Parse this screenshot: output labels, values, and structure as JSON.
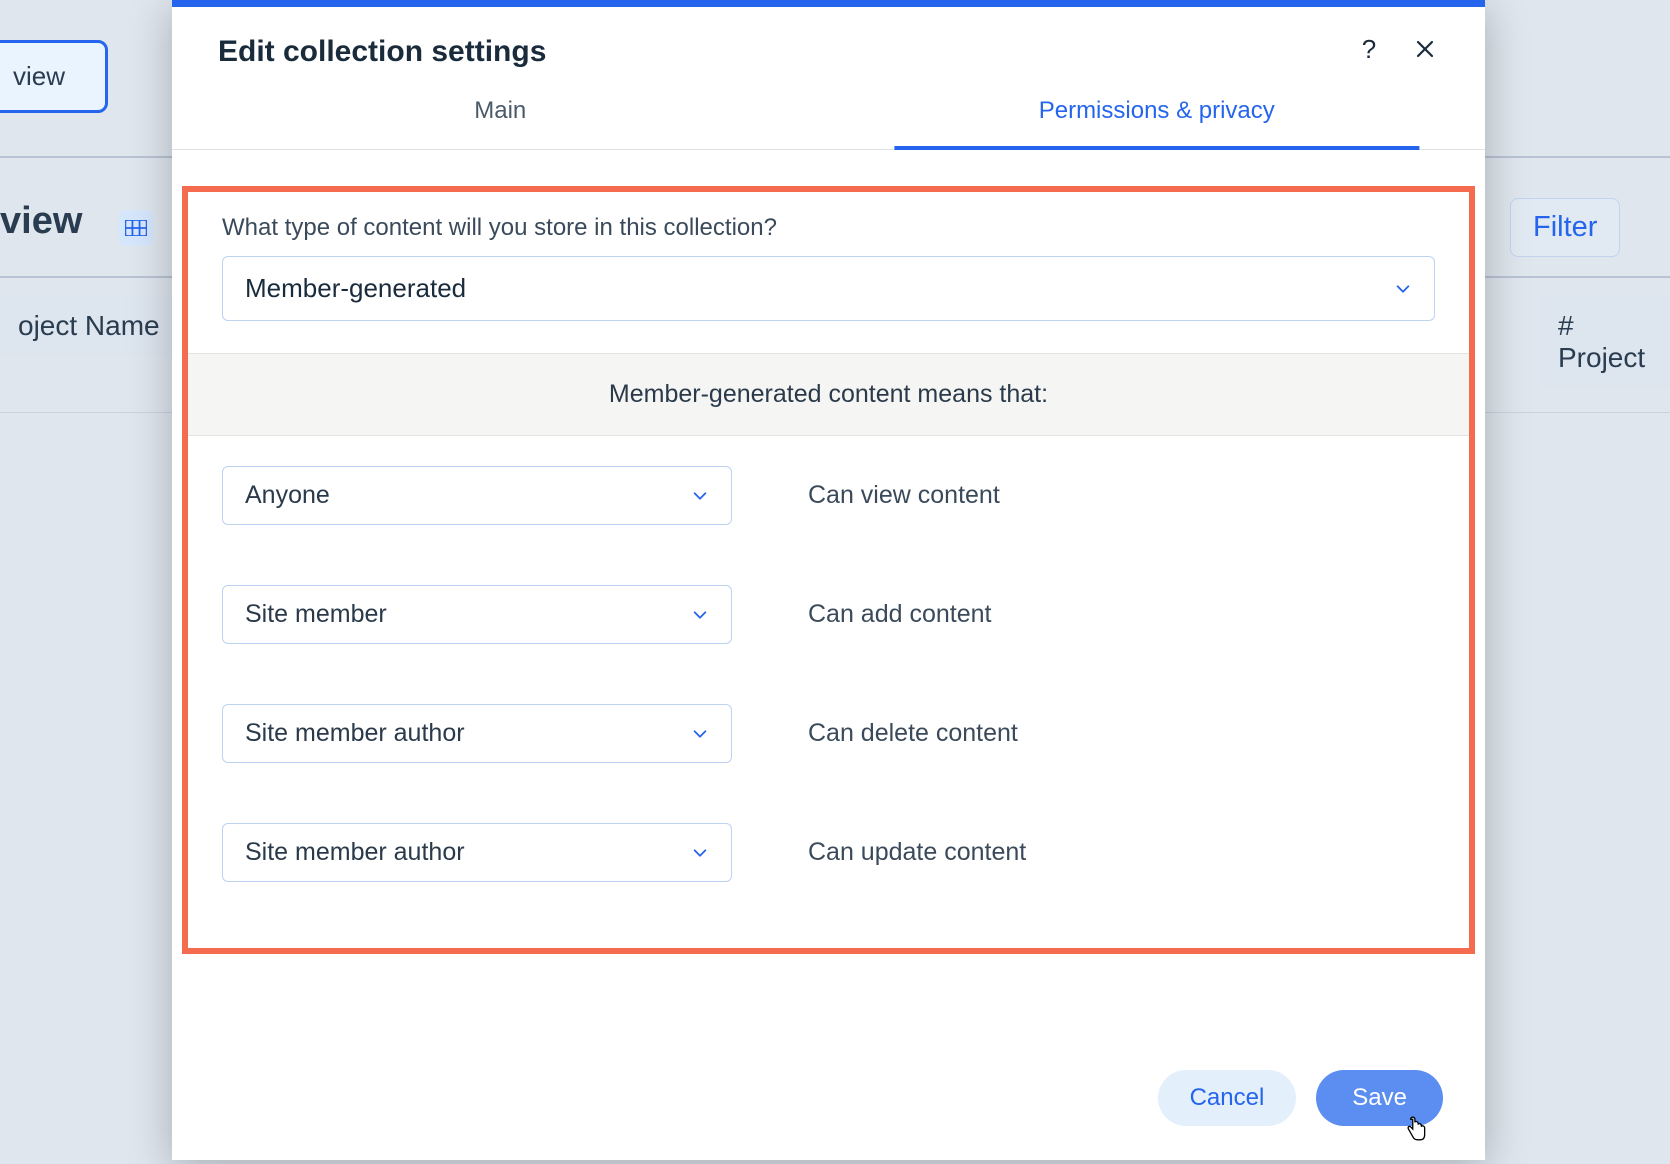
{
  "background": {
    "view_button": "view",
    "view_label": "view",
    "filter": "Filter",
    "col_left": "oject Name",
    "col_right": "#  Project"
  },
  "modal": {
    "title": "Edit collection settings",
    "tabs": {
      "main": "Main",
      "permissions": "Permissions & privacy"
    },
    "question": "What type of content will you store in this collection?",
    "content_type": "Member-generated",
    "banner": "Member-generated content means that:",
    "permissions": [
      {
        "who": "Anyone",
        "what": "Can view content"
      },
      {
        "who": "Site member",
        "what": "Can add content"
      },
      {
        "who": "Site member author",
        "what": "Can delete content"
      },
      {
        "who": "Site member author",
        "what": "Can update content"
      }
    ],
    "buttons": {
      "cancel": "Cancel",
      "save": "Save"
    }
  }
}
